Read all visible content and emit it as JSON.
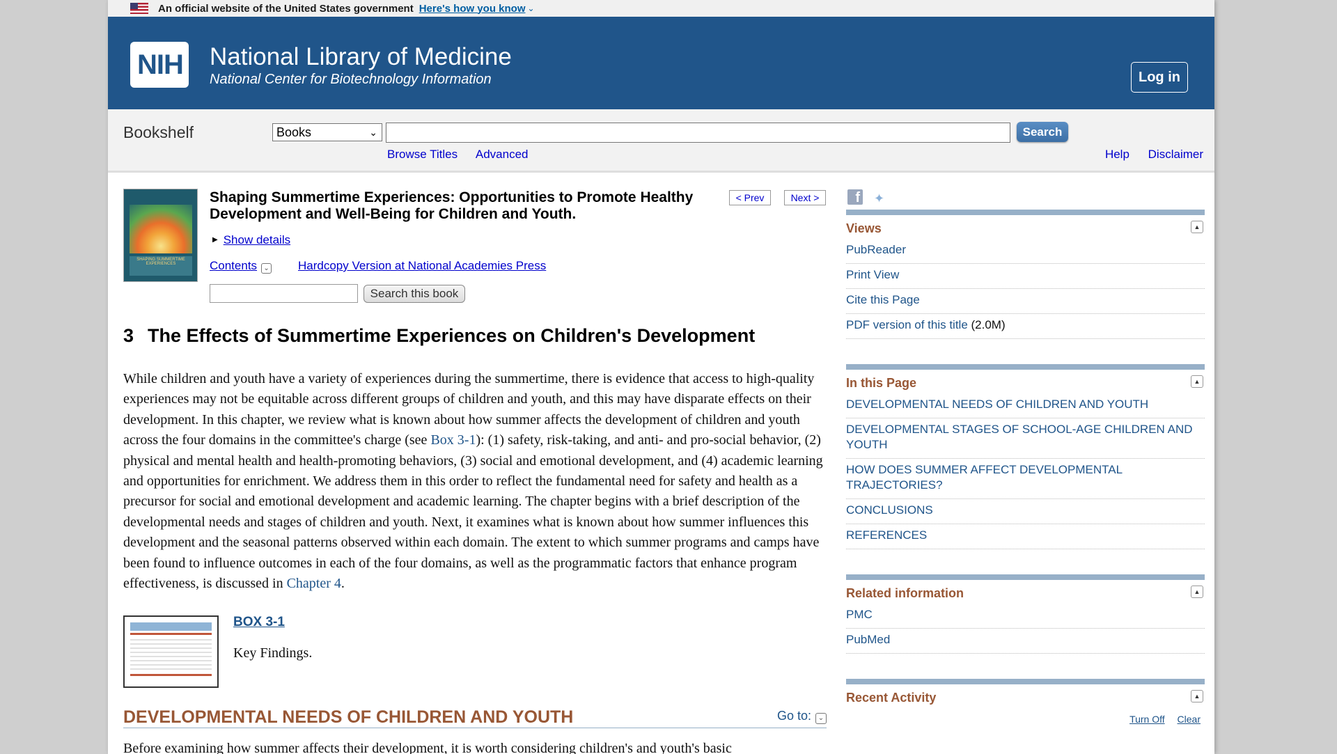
{
  "gov_banner": {
    "text": "An official website of the United States government",
    "link": "Here's how you know"
  },
  "header": {
    "logo_text": "NIH",
    "title": "National Library of Medicine",
    "subtitle": "National Center for Biotechnology Information",
    "login": "Log in"
  },
  "search": {
    "section_label": "Bookshelf",
    "db_selected": "Books",
    "input_value": "",
    "button": "Search",
    "links": [
      "Browse Titles",
      "Advanced"
    ],
    "right_links": [
      "Help",
      "Disclaimer"
    ]
  },
  "book": {
    "title": "Shaping Summertime Experiences: Opportunities to Promote Healthy Development and Well-Being for Children and Youth.",
    "prev": "< Prev",
    "next": "Next >",
    "show_details": "Show details",
    "contents": "Contents",
    "hardcopy": "Hardcopy Version at National Academies Press",
    "search_input_value": "",
    "search_button": "Search this book",
    "cover_caption": "SHAPING SUMMERTIME EXPERIENCES"
  },
  "chapter": {
    "number": "3",
    "title": "The Effects of Summertime Experiences on Children's Development",
    "para_before_box": "While children and youth have a variety of experiences during the summertime, there is evidence that access to high-quality experiences may not be equitable across different groups of children and youth, and this may have disparate effects on their development. In this chapter, we review what is known about how summer affects the development of children and youth across the four domains in the committee's charge (see ",
    "box_ref": "Box 3-1",
    "para_after_box": "): (1) safety, risk-taking, and anti- and pro-social behavior, (2) physical and mental health and health-promoting behaviors, (3) social and emotional development, and (4) academic learning and opportunities for enrichment. We address them in this order to reflect the fundamental need for safety and health as a precursor for social and emotional development and academic learning. The chapter begins with a brief description of the developmental needs and stages of children and youth. Next, it examines what is known about how summer influences this development and the seasonal patterns observed within each domain. The extent to which summer programs and camps have been found to influence outcomes in each of the four domains, as well as the programmatic factors that enhance program effectiveness, is discussed in ",
    "chapter_ref": "Chapter 4",
    "para_end": ".",
    "box_link": "BOX 3-1",
    "box_caption": "Key Findings.",
    "section_heading": "DEVELOPMENTAL NEEDS OF CHILDREN AND YOUTH",
    "goto": "Go to:",
    "next_para": "Before examining how summer affects their development, it is worth considering children's and youth's basic"
  },
  "sidebar": {
    "views": {
      "title": "Views",
      "items": [
        "PubReader",
        "Print View",
        "Cite this Page",
        "PDF version of this title"
      ],
      "pdf_size": "(2.0M)"
    },
    "in_this_page": {
      "title": "In this Page",
      "items": [
        "DEVELOPMENTAL NEEDS OF CHILDREN AND YOUTH",
        "DEVELOPMENTAL STAGES OF SCHOOL-AGE CHILDREN AND YOUTH",
        "HOW DOES SUMMER AFFECT DEVELOPMENTAL TRAJECTORIES?",
        "CONCLUSIONS",
        "REFERENCES"
      ]
    },
    "related": {
      "title": "Related information",
      "items": [
        "PMC",
        "PubMed"
      ]
    },
    "recent": {
      "title": "Recent Activity",
      "turn_off": "Turn Off",
      "clear": "Clear"
    }
  },
  "colors": {
    "header_bg": "#20558a",
    "section_heading": "#985735",
    "sidebar_rule": "#97b0c8",
    "link": "#0000cc"
  }
}
